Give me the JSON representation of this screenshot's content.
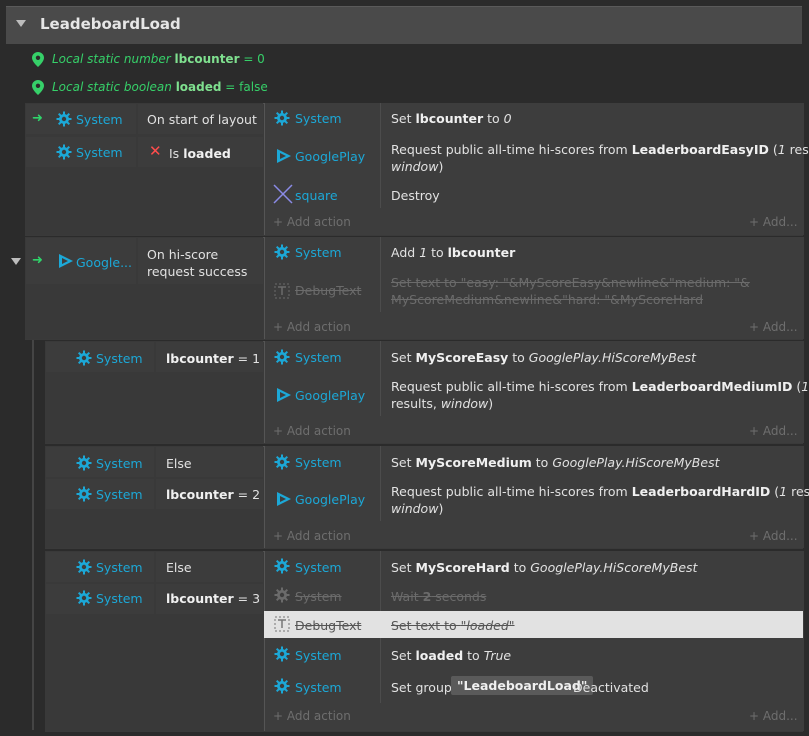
{
  "group": {
    "title": "LeadeboardLoad"
  },
  "variables": [
    {
      "prefix": "Local static number ",
      "name": "lbcounter",
      "suffix": " = 0"
    },
    {
      "prefix": "Local static boolean ",
      "name": "loaded",
      "suffix": " = false"
    }
  ],
  "events": {
    "e1": {
      "cond1": {
        "obj": "System",
        "text": "On start of layout"
      },
      "cond2": {
        "obj": "System",
        "not": "✕",
        "pre": "Is ",
        "bold": "loaded"
      },
      "a1": {
        "obj": "System",
        "pre": "Set ",
        "bold": "lbcounter",
        "mid": " to ",
        "ital": "0"
      },
      "a2": {
        "obj": "GooglePlay",
        "pre": "Request public all-time hi-scores from ",
        "bold": "LeaderboardEasyID",
        "mid": " (",
        "ital": "1",
        "mid2": " results, ",
        "ital2": "window",
        "end": ")"
      },
      "a3": {
        "obj": "square",
        "text": "Destroy"
      }
    },
    "e2": {
      "cond1": {
        "obj": "Google...",
        "text1": "On hi-score",
        "text2": "request success"
      },
      "a1": {
        "obj": "System",
        "pre": "Add ",
        "ital": "1",
        "mid": " to ",
        "bold": "lbcounter"
      },
      "a2": {
        "obj": "DebugText",
        "line1": "Set text to \"easy: \"&MyScoreEasy&newline&\"medium: \"&",
        "line2": "MyScoreMedium&newline&\"hard: \"&MyScoreHard"
      }
    },
    "e3": {
      "cond1": {
        "obj": "System",
        "bold": "lbcounter",
        "suffix": " = 1"
      },
      "a1": {
        "obj": "System",
        "pre": "Set ",
        "bold": "MyScoreEasy",
        "mid": " to ",
        "ital": "GooglePlay.HiScoreMyBest"
      },
      "a2": {
        "obj": "GooglePlay",
        "pre": "Request public all-time hi-scores from ",
        "bold": "LeaderboardMediumID",
        "mid": " (",
        "ital": "1",
        "mid2": "results, ",
        "ital2": "window",
        "end": ")"
      }
    },
    "e4": {
      "cond1": {
        "obj": "System",
        "text": "Else"
      },
      "cond2": {
        "obj": "System",
        "bold": "lbcounter",
        "suffix": " = 2"
      },
      "a1": {
        "obj": "System",
        "pre": "Set ",
        "bold": "MyScoreMedium",
        "mid": " to ",
        "ital": "GooglePlay.HiScoreMyBest"
      },
      "a2": {
        "obj": "GooglePlay",
        "pre": "Request public all-time hi-scores from ",
        "bold": "LeaderboardHardID",
        "mid": " (",
        "ital": "1",
        "mid2": " results, ",
        "ital2": "window",
        "end": ")"
      }
    },
    "e5": {
      "cond1": {
        "obj": "System",
        "text": "Else"
      },
      "cond2": {
        "obj": "System",
        "bold": "lbcounter",
        "suffix": " = 3"
      },
      "a1": {
        "obj": "System",
        "pre": "Set ",
        "bold": "MyScoreHard",
        "mid": " to ",
        "ital": "GooglePlay.HiScoreMyBest"
      },
      "a2": {
        "obj": "System",
        "pre": "Wait ",
        "bold": "2",
        "suf": " seconds"
      },
      "a3": {
        "obj": "DebugText",
        "pre": "Set text to ",
        "ital": "\"loaded\""
      },
      "a4": {
        "obj": "System",
        "pre": "Set ",
        "bold": "loaded",
        "mid": " to ",
        "ital": "True"
      },
      "a5": {
        "obj": "System",
        "pre": "Set group ",
        "badge": "\"LeadeboardLoad\"",
        "suf": " Deactivated"
      }
    }
  },
  "ui": {
    "add_action": "+ Add action",
    "add_more": "+ Add..."
  },
  "colors": {
    "object_blue": "#1ca8d7",
    "variable_green": "#36d069",
    "disabled": "#6b6b6b"
  }
}
